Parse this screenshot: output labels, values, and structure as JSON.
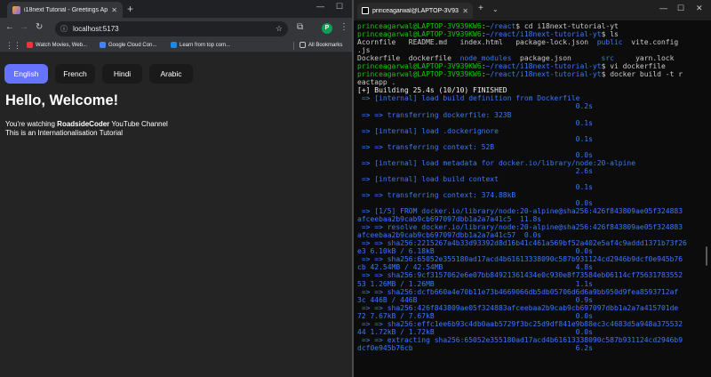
{
  "browser": {
    "tab_title": "i18next Tutorial - Greetings Ap",
    "url": "localhost:5173",
    "profile_initial": "P",
    "bookmarks": [
      {
        "label": "Watch Movies, Web..."
      },
      {
        "label": "Google Cloud Con..."
      },
      {
        "label": "Learn from top com..."
      }
    ],
    "all_bookmarks": "All Bookmarks",
    "page": {
      "languages": [
        "English",
        "French",
        "Hindi",
        "Arabic"
      ],
      "active_language": "English",
      "heading": "Hello, Welcome!",
      "line1_prefix": "You're watching ",
      "line1_bold": "RoadsideCoder",
      "line1_suffix": " YouTube Channel",
      "line2": "This is an Internationalisation Tutorial"
    }
  },
  "terminal": {
    "tab_title": "princeagarwal@LAPTOP-3V93",
    "lines": [
      {
        "segs": [
          {
            "c": "g",
            "t": "princeagarwal@LAPTOP-3V939KW6"
          },
          {
            "c": "w",
            "t": ":"
          },
          {
            "c": "b",
            "t": "~/react"
          },
          {
            "c": "w",
            "t": "$ cd i18next-tutorial-yt"
          }
        ]
      },
      {
        "segs": [
          {
            "c": "g",
            "t": "princeagarwal@LAPTOP-3V939KW6"
          },
          {
            "c": "w",
            "t": ":"
          },
          {
            "c": "b",
            "t": "~/react/i18next-tutorial-yt"
          },
          {
            "c": "w",
            "t": "$ ls"
          }
        ]
      },
      {
        "segs": [
          {
            "c": "w",
            "t": "Acornfile   README.md   index.html   package-lock.json  "
          },
          {
            "c": "b",
            "t": "public"
          },
          {
            "c": "w",
            "t": "  vite.config"
          }
        ]
      },
      {
        "segs": [
          {
            "c": "w",
            "t": ".js"
          }
        ]
      },
      {
        "segs": [
          {
            "c": "w",
            "t": "Dockerfile  dockerfile  "
          },
          {
            "c": "b",
            "t": "node_modules"
          },
          {
            "c": "w",
            "t": "  package.json       "
          },
          {
            "c": "b",
            "t": "src"
          },
          {
            "c": "w",
            "t": "     yarn.lock"
          }
        ]
      },
      {
        "segs": [
          {
            "c": "g",
            "t": "princeagarwal@LAPTOP-3V939KW6"
          },
          {
            "c": "w",
            "t": ":"
          },
          {
            "c": "b",
            "t": "~/react/i18next-tutorial-yt"
          },
          {
            "c": "w",
            "t": "$ vi dockerfile"
          }
        ]
      },
      {
        "segs": [
          {
            "c": "g",
            "t": "princeagarwal@LAPTOP-3V939KW6"
          },
          {
            "c": "w",
            "t": ":"
          },
          {
            "c": "b",
            "t": "~/react/i18next-tutorial-yt"
          },
          {
            "c": "w",
            "t": "$ docker build -t r"
          }
        ]
      },
      {
        "segs": [
          {
            "c": "w",
            "t": "eactapp ."
          }
        ]
      },
      {
        "segs": [
          {
            "c": "W",
            "t": "[+] Building 25.4s (10/10) FINISHED"
          }
        ]
      },
      {
        "segs": [
          {
            "c": "b",
            "t": " => [internal] load build definition from Dockerfile"
          }
        ]
      },
      {
        "segs": [
          {
            "c": "b",
            "t": "                                                   0.2s"
          }
        ]
      },
      {
        "segs": [
          {
            "c": "b",
            "t": " => => transferring dockerfile: 323B"
          }
        ]
      },
      {
        "segs": [
          {
            "c": "b",
            "t": "                                                   0.1s"
          }
        ]
      },
      {
        "segs": [
          {
            "c": "b",
            "t": " => [internal] load .dockerignore"
          }
        ]
      },
      {
        "segs": [
          {
            "c": "b",
            "t": "                                                   0.1s"
          }
        ]
      },
      {
        "segs": [
          {
            "c": "b",
            "t": " => => transferring context: 52B"
          }
        ]
      },
      {
        "segs": [
          {
            "c": "b",
            "t": "                                                   0.0s"
          }
        ]
      },
      {
        "segs": [
          {
            "c": "b",
            "t": " => [internal] load metadata for docker.io/library/node:20-alpine"
          }
        ]
      },
      {
        "segs": [
          {
            "c": "b",
            "t": "                                                   2.6s"
          }
        ]
      },
      {
        "segs": [
          {
            "c": "b",
            "t": " => [internal] load build context"
          }
        ]
      },
      {
        "segs": [
          {
            "c": "b",
            "t": "                                                   0.1s"
          }
        ]
      },
      {
        "segs": [
          {
            "c": "b",
            "t": " => => transferring context: 374.88kB"
          }
        ]
      },
      {
        "segs": [
          {
            "c": "b",
            "t": "                                                   0.0s"
          }
        ]
      },
      {
        "segs": [
          {
            "c": "b",
            "t": " => [1/5] FROM docker.io/library/node:20-alpine@sha256:426f843809ae05f324883"
          }
        ]
      },
      {
        "segs": [
          {
            "c": "b",
            "t": "afceebaa2b9cab9cb697097dbb1a2a7a41c5  11.8s"
          }
        ]
      },
      {
        "segs": [
          {
            "c": "b",
            "t": " => => resolve docker.io/library/node:20-alpine@sha256:426f843809ae05f324883"
          }
        ]
      },
      {
        "segs": [
          {
            "c": "b",
            "t": "afceebaa2b9cab9cb697097dbb1a2a7a41c57  0.0s"
          }
        ]
      },
      {
        "segs": [
          {
            "c": "b",
            "t": " => => sha256:2215267a4b33d93392d8d16b41c461a569bf52a402e5af4c9addd1371b73f26"
          }
        ]
      },
      {
        "segs": [
          {
            "c": "b",
            "t": "e3 6.10kB / 6.18kB                                 0.0s"
          }
        ]
      },
      {
        "segs": [
          {
            "c": "b",
            "t": " => => sha256:65052e355180ad17acd4b61613338090c587b931124cd2946b9dcf0e945b76"
          }
        ]
      },
      {
        "segs": [
          {
            "c": "b",
            "t": "cb 42.54MB / 42.54MB                               4.8s"
          }
        ]
      },
      {
        "segs": [
          {
            "c": "b",
            "t": " => => sha256:9cf3157062e6e07bb84921361434e0c930e8f73584eb06114cf75631783552"
          }
        ]
      },
      {
        "segs": [
          {
            "c": "b",
            "t": "53 1.26MB / 1.26MB                                 1.1s"
          }
        ]
      },
      {
        "segs": [
          {
            "c": "b",
            "t": " => => sha256:dcfb660a4e70b11e73b4669066db5db05706d6d6a9bb950d9fea8593712af"
          }
        ]
      },
      {
        "segs": [
          {
            "c": "b",
            "t": "3c 446B / 446B                                     0.9s"
          }
        ]
      },
      {
        "segs": [
          {
            "c": "b",
            "t": " => => sha256:426f843809ae05f324883afceebaa2b9cab9cb697097dbb1a2a7a415701de"
          }
        ]
      },
      {
        "segs": [
          {
            "c": "b",
            "t": "72 7.67kB / 7.67kB                                 0.0s"
          }
        ]
      },
      {
        "segs": [
          {
            "c": "b",
            "t": " => => sha256:effc1ee6b93c4db0aab5729f3bc25d9df841e9b88ec3c4683d5a948a375532"
          }
        ]
      },
      {
        "segs": [
          {
            "c": "b",
            "t": "44 1.72kB / 1.72kB                                 0.0s"
          }
        ]
      },
      {
        "segs": [
          {
            "c": "b",
            "t": " => => extracting sha256:65052e355180ad17acd4b61613338090c587b931124cd2946b9"
          }
        ]
      },
      {
        "segs": [
          {
            "c": "b",
            "t": "dcf0e945b76cb                                      6.2s"
          }
        ]
      }
    ]
  },
  "colors": {
    "accent_button": "#6673ff",
    "terminal_green": "#16c60c",
    "terminal_blue": "#3b78ff"
  }
}
